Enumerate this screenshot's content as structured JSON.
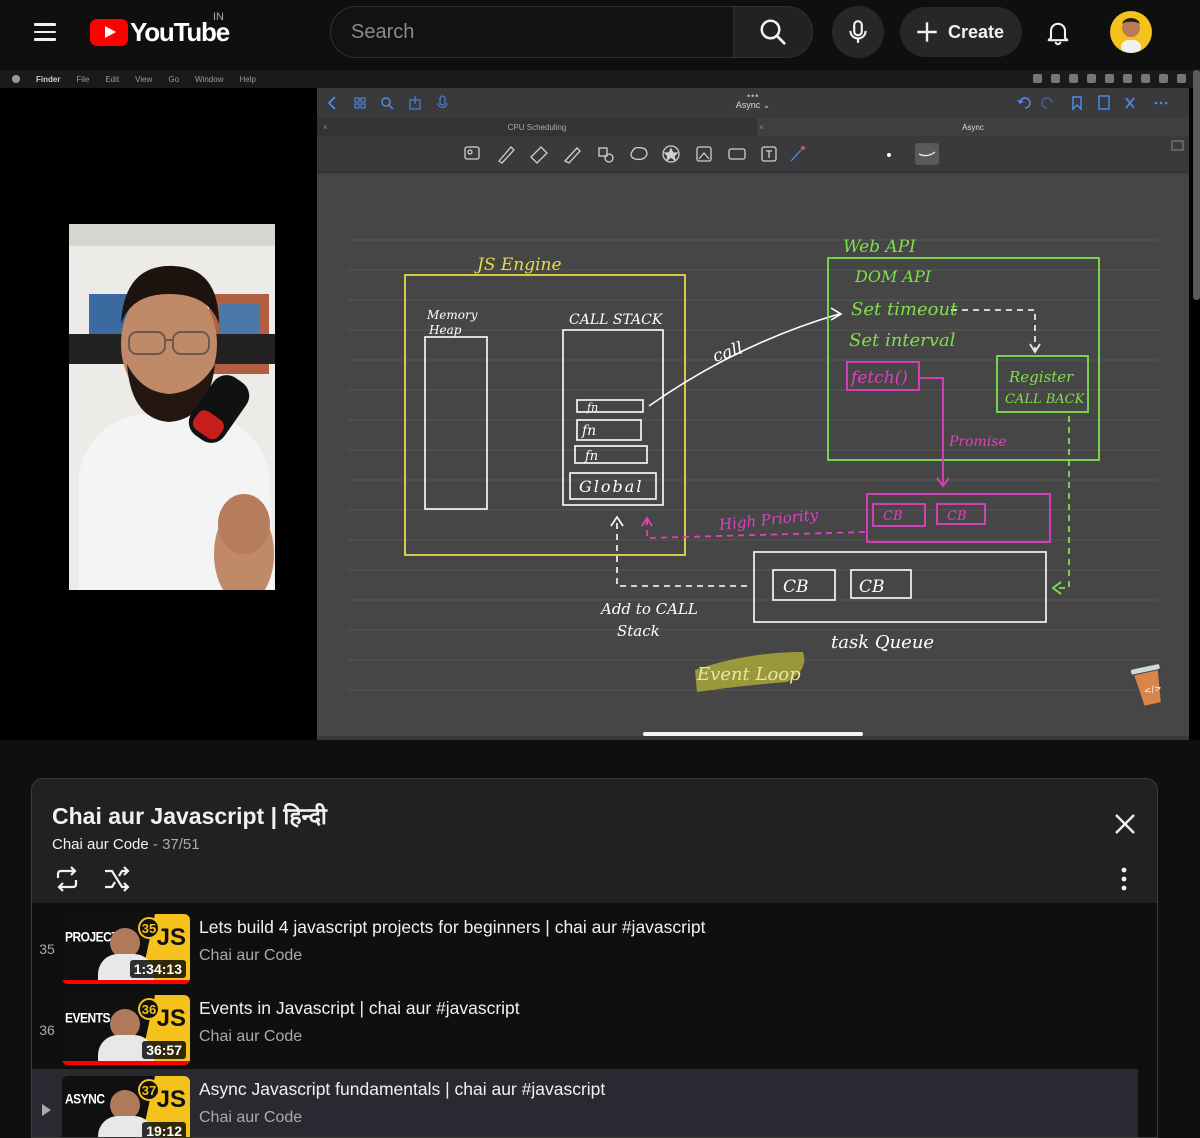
{
  "header": {
    "logo_text": "YouTube",
    "country_code": "IN",
    "search_placeholder": "Search",
    "create_label": "Create"
  },
  "player": {
    "mac_menu": [
      "Finder",
      "File",
      "Edit",
      "View",
      "Go",
      "Window",
      "Help"
    ],
    "notes_app": {
      "document_title": "Async",
      "tabs": [
        "CPU Scheduling",
        "Async"
      ]
    },
    "whiteboard": {
      "js_engine_label": "JS Engine",
      "memory_heap_label": "Memory Heap",
      "call_stack_label": "CALL STACK",
      "stack_frames": [
        "fn",
        "fn",
        "fn",
        "Global"
      ],
      "call_label": "call",
      "web_api_label": "Web API",
      "web_api_items": [
        "DOM API",
        "Set timeout",
        "Set interval",
        "fetch()"
      ],
      "register_callback_label": "Register CALL BACK",
      "promise_label": "Promise",
      "high_priority_label": "High Priority",
      "priority_queue_items": [
        "CB",
        "CB"
      ],
      "task_queue_items": [
        "CB",
        "CB"
      ],
      "task_queue_label": "task Queue",
      "add_to_call_stack_label": "Add to CALL Stack",
      "event_loop_label": "Event Loop"
    }
  },
  "playlist": {
    "title": "Chai aur Javascript | हिन्दी",
    "channel": "Chai aur Code",
    "position": "37/51",
    "items": [
      {
        "index": "35",
        "thumb_label": "PROJECTS",
        "thumb_number": "35",
        "thumb_badge": "JS",
        "duration": "1:34:13",
        "title": "Lets build 4 javascript projects for beginners | chai aur #javascript",
        "channel": "Chai aur Code"
      },
      {
        "index": "36",
        "thumb_label": "EVENTS",
        "thumb_number": "36",
        "thumb_badge": "JS",
        "duration": "36:57",
        "title": "Events in Javascript | chai aur #javascript",
        "channel": "Chai aur Code"
      },
      {
        "index": "37",
        "thumb_label": "ASYNC",
        "thumb_number": "37",
        "thumb_badge": "JS",
        "duration": "19:12",
        "title": "Async Javascript fundamentals | chai aur #javascript",
        "channel": "Chai aur Code"
      }
    ]
  },
  "colors": {
    "brand_red": "#ff0000",
    "thumb_yellow": "#f4c21a",
    "wb_yellow": "#e8d84a",
    "wb_green": "#7fe04a",
    "wb_magenta": "#e040c0"
  }
}
